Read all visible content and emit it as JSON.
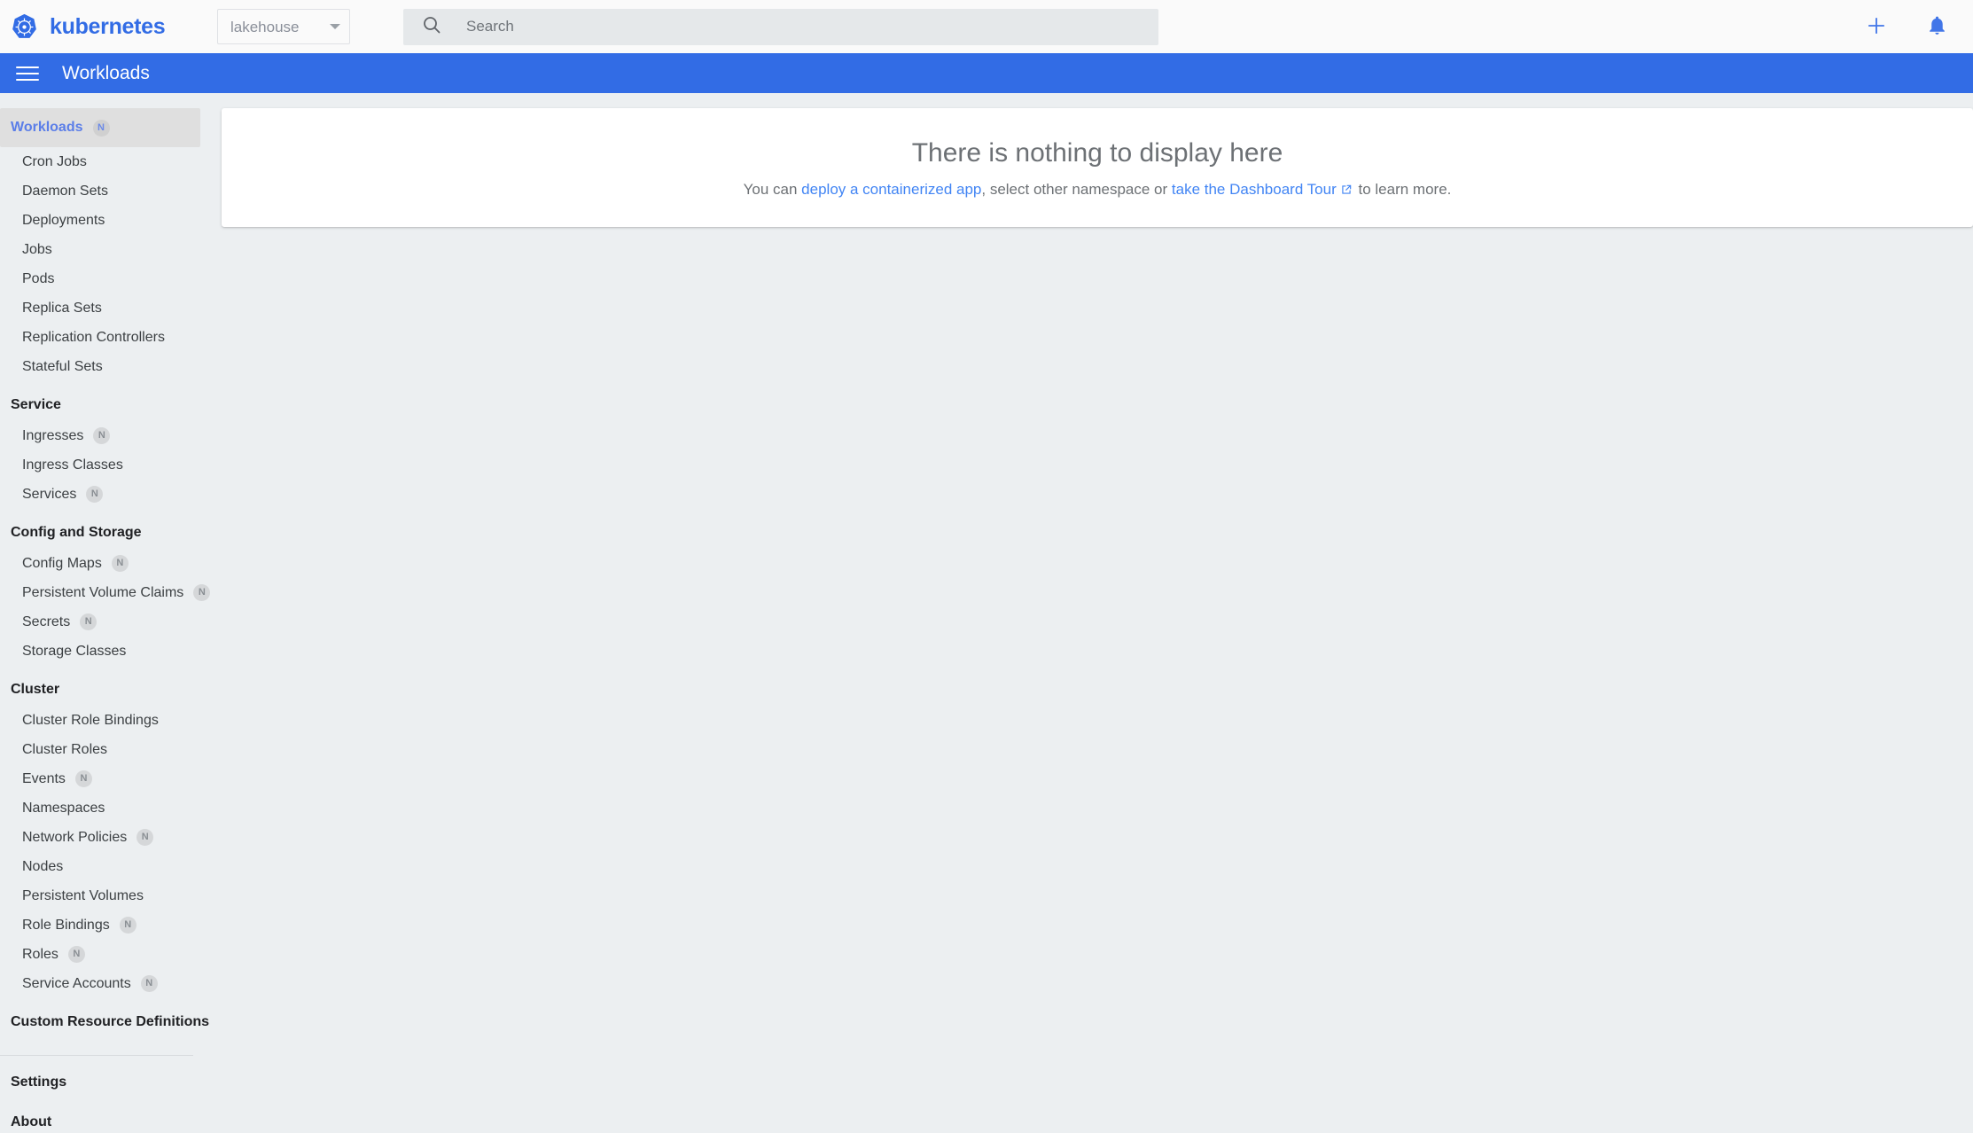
{
  "header": {
    "brand_name": "kubernetes",
    "logo_icon": "kubernetes-logo",
    "namespace": {
      "selected": "lakehouse",
      "caret_icon": "chevron-down-icon"
    },
    "search": {
      "placeholder": "Search",
      "value": "",
      "icon": "search-icon"
    },
    "actions": [
      {
        "name": "create-button",
        "icon": "plus-icon"
      },
      {
        "name": "notifications-button",
        "icon": "bell-icon"
      }
    ]
  },
  "toolbar": {
    "menu_icon": "hamburger-menu-icon",
    "title": "Workloads"
  },
  "sidebar": {
    "groups": [
      {
        "header": null,
        "items": [
          {
            "label": "Workloads",
            "badge": "N",
            "active": true,
            "type": "item"
          },
          {
            "label": "Cron Jobs",
            "badge": null,
            "active": false,
            "type": "item"
          },
          {
            "label": "Daemon Sets",
            "badge": null,
            "active": false,
            "type": "item"
          },
          {
            "label": "Deployments",
            "badge": null,
            "active": false,
            "type": "item"
          },
          {
            "label": "Jobs",
            "badge": null,
            "active": false,
            "type": "item"
          },
          {
            "label": "Pods",
            "badge": null,
            "active": false,
            "type": "item"
          },
          {
            "label": "Replica Sets",
            "badge": null,
            "active": false,
            "type": "item"
          },
          {
            "label": "Replication Controllers",
            "badge": null,
            "active": false,
            "type": "item"
          },
          {
            "label": "Stateful Sets",
            "badge": null,
            "active": false,
            "type": "item"
          }
        ]
      },
      {
        "header": "Service",
        "items": [
          {
            "label": "Ingresses",
            "badge": "N",
            "active": false,
            "type": "item"
          },
          {
            "label": "Ingress Classes",
            "badge": null,
            "active": false,
            "type": "item"
          },
          {
            "label": "Services",
            "badge": "N",
            "active": false,
            "type": "item"
          }
        ]
      },
      {
        "header": "Config and Storage",
        "items": [
          {
            "label": "Config Maps",
            "badge": "N",
            "active": false,
            "type": "item"
          },
          {
            "label": "Persistent Volume Claims",
            "badge": "N",
            "active": false,
            "type": "item"
          },
          {
            "label": "Secrets",
            "badge": "N",
            "active": false,
            "type": "item"
          },
          {
            "label": "Storage Classes",
            "badge": null,
            "active": false,
            "type": "item"
          }
        ]
      },
      {
        "header": "Cluster",
        "items": [
          {
            "label": "Cluster Role Bindings",
            "badge": null,
            "active": false,
            "type": "item"
          },
          {
            "label": "Cluster Roles",
            "badge": null,
            "active": false,
            "type": "item"
          },
          {
            "label": "Events",
            "badge": "N",
            "active": false,
            "type": "item"
          },
          {
            "label": "Namespaces",
            "badge": null,
            "active": false,
            "type": "item"
          },
          {
            "label": "Network Policies",
            "badge": "N",
            "active": false,
            "type": "item"
          },
          {
            "label": "Nodes",
            "badge": null,
            "active": false,
            "type": "item"
          },
          {
            "label": "Persistent Volumes",
            "badge": null,
            "active": false,
            "type": "item"
          },
          {
            "label": "Role Bindings",
            "badge": "N",
            "active": false,
            "type": "item"
          },
          {
            "label": "Roles",
            "badge": "N",
            "active": false,
            "type": "item"
          },
          {
            "label": "Service Accounts",
            "badge": "N",
            "active": false,
            "type": "item"
          }
        ]
      },
      {
        "header": "Custom Resource Definitions",
        "header_clickable": true,
        "items": []
      }
    ],
    "footer_items": [
      {
        "label": "Settings"
      },
      {
        "label": "About"
      }
    ]
  },
  "main": {
    "empty_state": {
      "title": "There is nothing to display here",
      "prefix": "You can ",
      "link1": "deploy a containerized app",
      "middle": ", select other namespace or ",
      "link2": "take the Dashboard Tour",
      "external_icon": "external-link-icon",
      "suffix": " to learn more."
    }
  },
  "colors": {
    "brand_blue": "#326ce5",
    "link_blue": "#4285f4",
    "toolbar_blue": "#326ce5",
    "page_bg": "#eceff1",
    "card_bg": "#ffffff",
    "active_item_bg": "#dfdfdf"
  }
}
